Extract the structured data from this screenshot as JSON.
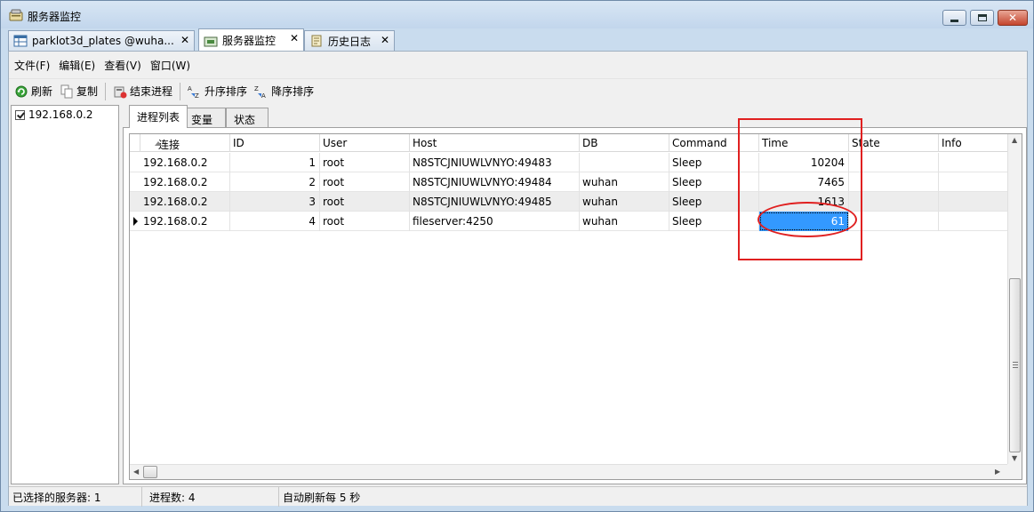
{
  "window": {
    "title": "服务器监控",
    "icon": "server-monitor-icon"
  },
  "doc_tabs": [
    {
      "label": "parklot3d_plates @wuha...",
      "icon": "table-icon",
      "active": false
    },
    {
      "label": "服务器监控",
      "icon": "server-monitor-icon",
      "active": true
    },
    {
      "label": "历史日志",
      "icon": "history-log-icon",
      "active": false
    }
  ],
  "menu": [
    "文件(F)",
    "编辑(E)",
    "查看(V)",
    "窗口(W)"
  ],
  "toolbar": {
    "refresh": "刷新",
    "copy": "复制",
    "kill_process": "结束进程",
    "sort_asc": "升序排序",
    "sort_desc": "降序排序"
  },
  "servers": [
    {
      "name": "192.168.0.2",
      "checked": true
    }
  ],
  "sub_tabs": [
    "进程列表",
    "变量",
    "状态"
  ],
  "table": {
    "columns": [
      "连接",
      "ID",
      "User",
      "Host",
      "DB",
      "Command",
      "Time",
      "State",
      "Info"
    ],
    "rows": [
      {
        "conn": "192.168.0.2",
        "id": "1",
        "user": "root",
        "host": "N8STCJNIUWLVNYO:49483",
        "db": "",
        "command": "Sleep",
        "time": "10204",
        "state": "",
        "info": ""
      },
      {
        "conn": "192.168.0.2",
        "id": "2",
        "user": "root",
        "host": "N8STCJNIUWLVNYO:49484",
        "db": "wuhan",
        "command": "Sleep",
        "time": "7465",
        "state": "",
        "info": ""
      },
      {
        "conn": "192.168.0.2",
        "id": "3",
        "user": "root",
        "host": "N8STCJNIUWLVNYO:49485",
        "db": "wuhan",
        "command": "Sleep",
        "time": "1613",
        "state": "",
        "info": ""
      },
      {
        "conn": "192.168.0.2",
        "id": "4",
        "user": "root",
        "host": "fileserver:4250",
        "db": "wuhan",
        "command": "Sleep",
        "time": "61",
        "state": "",
        "info": ""
      }
    ],
    "current_row": 4,
    "selected_cell": "Time"
  },
  "status": {
    "selected_servers": "已选择的服务器: 1",
    "process_count": "进程数: 4",
    "auto_refresh": "自动刷新每 5 秒"
  },
  "colors": {
    "selection": "#3399ff",
    "annotation": "#e02020",
    "window_frame": "#c9dcee"
  }
}
